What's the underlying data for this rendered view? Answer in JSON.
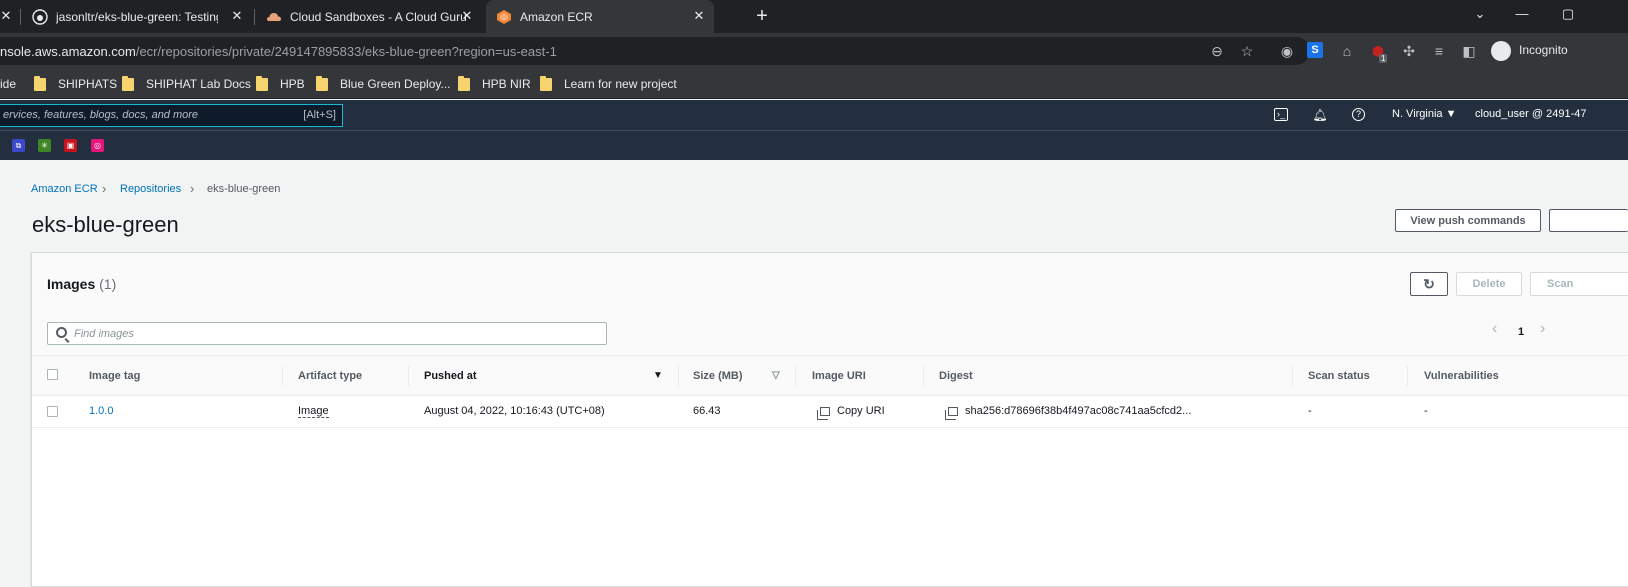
{
  "browser": {
    "tabs": [
      {
        "title": "jasonltr/eks-blue-green: Testing b",
        "active": false
      },
      {
        "title": "Cloud Sandboxes - A Cloud Guru",
        "active": false
      },
      {
        "title": "Amazon ECR",
        "active": true
      }
    ],
    "url_host": "nsole.aws.amazon.com",
    "url_path": "/ecr/repositories/private/249147895833/eks-blue-green?region=us-east-1",
    "profile_label": "Incognito",
    "extension_badge": "1",
    "bookmarks": [
      "ide",
      "SHIPHATS",
      "SHIPHAT Lab Docs",
      "HPB",
      "Blue Green Deploy...",
      "HPB NIR",
      "Learn for new project"
    ]
  },
  "aws_nav": {
    "search_placeholder": "ervices, features, blogs, docs, and more",
    "search_shortcut": "[Alt+S]",
    "region": "N. Virginia",
    "account": "cloud_user @ 2491-47"
  },
  "breadcrumb": [
    "Amazon ECR",
    "Repositories",
    "eks-blue-green"
  ],
  "page": {
    "title": "eks-blue-green",
    "view_push_commands": "View push commands"
  },
  "images_panel": {
    "title": "Images",
    "count": "(1)",
    "delete_label": "Delete",
    "scan_label": "Scan",
    "find_placeholder": "Find images",
    "page_number": "1",
    "columns": [
      "Image tag",
      "Artifact type",
      "Pushed at",
      "Size (MB)",
      "Image URI",
      "Digest",
      "Scan status",
      "Vulnerabilities"
    ],
    "rows": [
      {
        "image_tag": "1.0.0",
        "artifact_type": "Image",
        "pushed_at": "August 04, 2022, 10:16:43 (UTC+08)",
        "size_mb": "66.43",
        "image_uri": "Copy URI",
        "digest": "sha256:d78696f38b4f497ac08c741aa5cfcd2...",
        "scan_status": "-",
        "vulnerabilities": "-"
      }
    ]
  }
}
